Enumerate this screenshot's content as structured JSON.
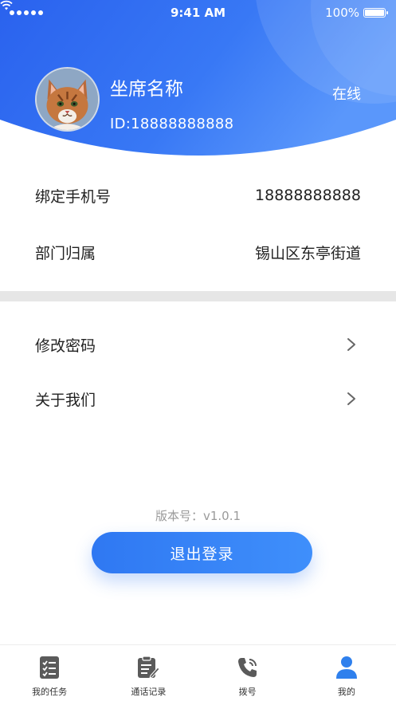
{
  "status_bar": {
    "time": "9:41 AM",
    "battery": "100%"
  },
  "profile": {
    "name": "坐席名称",
    "id_text": "ID:18888888888",
    "online_status": "在线",
    "avatar": "cat-avatar"
  },
  "info": {
    "phone_label": "绑定手机号",
    "phone_value": "18888888888",
    "dept_label": "部门归属",
    "dept_value": "锡山区东亭街道"
  },
  "menu": {
    "change_password": "修改密码",
    "about_us": "关于我们"
  },
  "version_text": "版本号：v1.0.1",
  "logout_label": "退出登录",
  "tabs": [
    {
      "label": "我的任务",
      "icon": "task-list-icon"
    },
    {
      "label": "通话记录",
      "icon": "call-record-icon"
    },
    {
      "label": "拨号",
      "icon": "phone-icon"
    },
    {
      "label": "我的",
      "icon": "user-icon",
      "active": true
    }
  ],
  "colors": {
    "primary": "#2f6ff0",
    "header_light": "#5b9bff",
    "tab_active": "#2f80ed",
    "tab_inactive": "#5a5a5a"
  }
}
